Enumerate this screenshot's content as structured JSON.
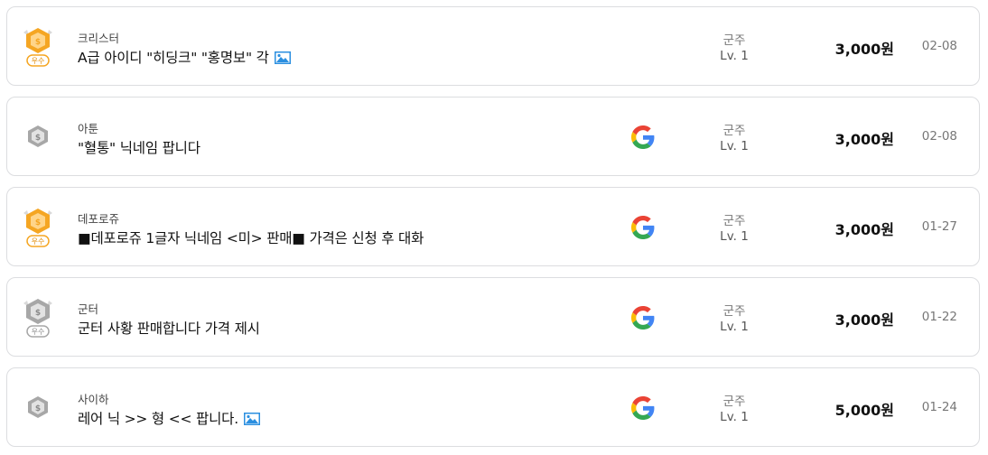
{
  "listings": [
    {
      "seller": "크리스터",
      "title": "A급 아이디 \"히딩크\" \"홍명보\" 각",
      "badge": "excellent-seller-badge",
      "badge_label": "우수",
      "has_image": true,
      "has_google": false,
      "server": "군주",
      "level": "Lv. 1",
      "price": "3,000원",
      "date": "02-08"
    },
    {
      "seller": "아툰",
      "title": "\"혈통\" 닉네임 팝니다",
      "badge": "seller-badge",
      "has_image": false,
      "has_google": true,
      "server": "군주",
      "level": "Lv. 1",
      "price": "3,000원",
      "date": "02-08"
    },
    {
      "seller": "데포로쥬",
      "title": "■데포로쥬 1글자 닉네임 <미> 판매■ 가격은 신청 후 대화",
      "badge": "excellent-seller-badge",
      "badge_label": "우수",
      "has_image": false,
      "has_google": true,
      "server": "군주",
      "level": "Lv. 1",
      "price": "3,000원",
      "date": "01-27"
    },
    {
      "seller": "군터",
      "title": "군터 사황 판매합니다 가격 제시",
      "badge": "excellent-seller-badge-gray",
      "badge_label": "우수",
      "has_image": false,
      "has_google": true,
      "server": "군주",
      "level": "Lv. 1",
      "price": "3,000원",
      "date": "01-22"
    },
    {
      "seller": "사이하",
      "title": "레어 닉 >> 형 << 팝니다.",
      "badge": "seller-badge",
      "has_image": true,
      "has_google": true,
      "server": "군주",
      "level": "Lv. 1",
      "price": "5,000원",
      "date": "01-24"
    }
  ],
  "colors": {
    "gold": "#f5a623",
    "gray_badge": "#a7a7a7",
    "card_border": "#dcdde0",
    "image_icon": "#2b8fe0"
  }
}
